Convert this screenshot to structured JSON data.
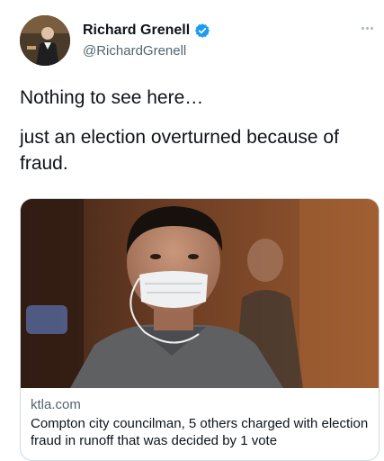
{
  "user": {
    "display_name": "Richard Grenell",
    "handle": "@RichardGrenell",
    "verified": true
  },
  "tweet": {
    "lines": [
      "Nothing to see here…",
      "just an election overturned because of",
      "fraud."
    ]
  },
  "link_card": {
    "domain": "ktla.com",
    "title": "Compton city councilman, 5 others charged with election fraud in runoff that was decided by 1 vote"
  },
  "icons": {
    "verified": "verified-badge-icon",
    "more": "more-options-icon"
  },
  "colors": {
    "verified": "#1d9bf0",
    "secondary_text": "#536471"
  }
}
